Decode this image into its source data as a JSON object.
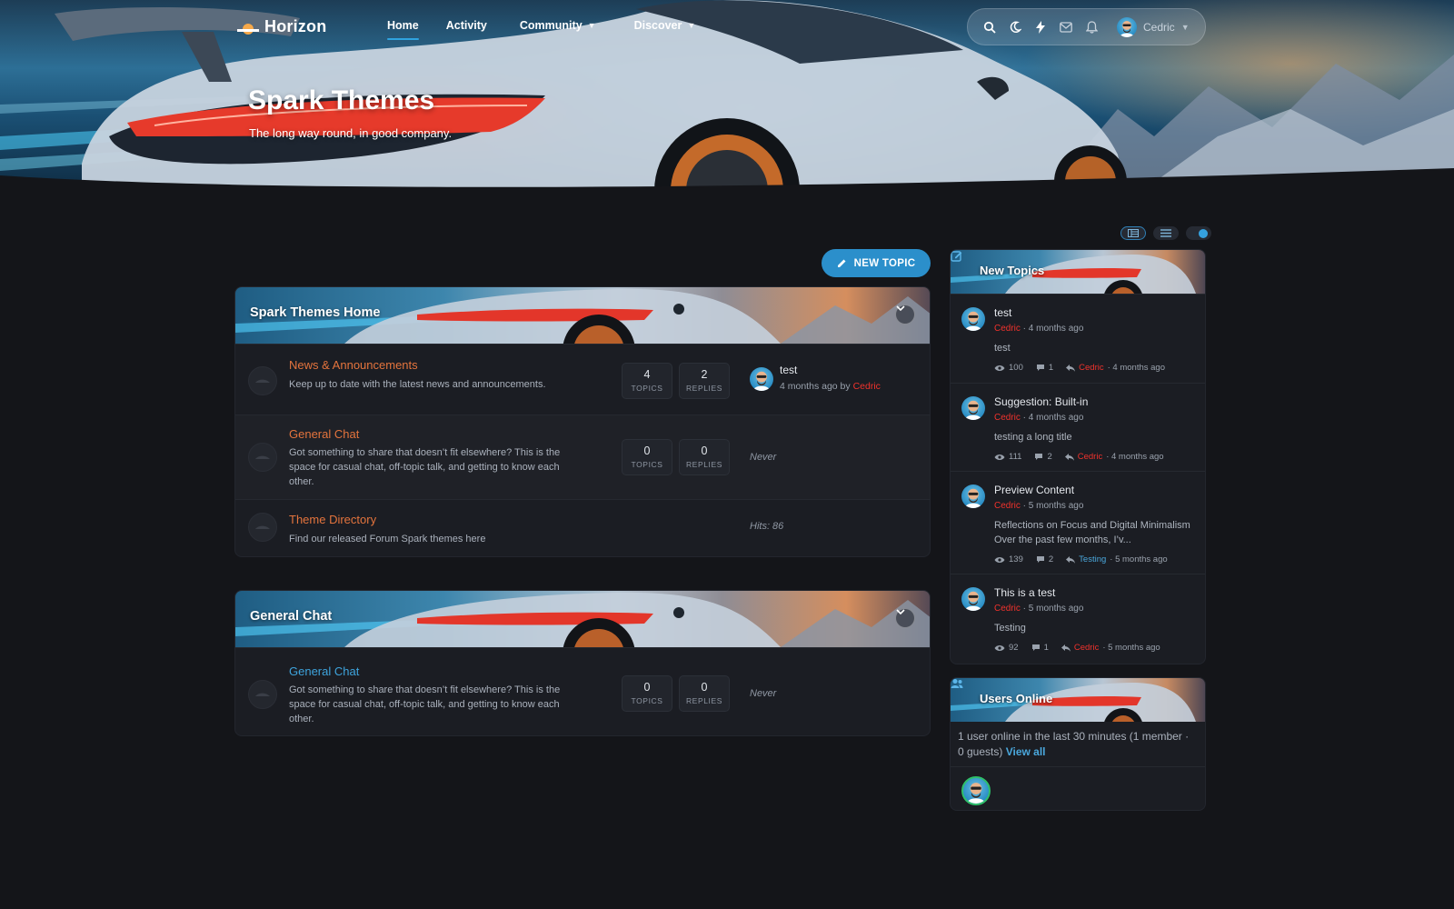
{
  "app": {
    "brand": "Horizon"
  },
  "nav": {
    "items": [
      {
        "label": "Home",
        "active": true,
        "dropdown": false
      },
      {
        "label": "Activity",
        "active": false,
        "dropdown": false
      },
      {
        "label": "Community",
        "active": false,
        "dropdown": true
      },
      {
        "label": "Discover",
        "active": false,
        "dropdown": true
      }
    ]
  },
  "toolbar": {
    "icons": [
      "search-icon",
      "moon-icon",
      "lightning-icon",
      "mail-icon",
      "bell-icon"
    ],
    "user_name": "Cedric"
  },
  "hero": {
    "title": "Spark Themes",
    "subtitle": "The long way round, in good company."
  },
  "actions": {
    "new_topic": "NEW TOPIC"
  },
  "categories": [
    {
      "title": "Spark Themes Home",
      "forums": [
        {
          "title": "News & Announcements",
          "description": "Keep up to date with the latest news and announcements.",
          "topics": "4",
          "replies": "2",
          "last_post": {
            "title": "test",
            "meta_prefix": "4 months ago by ",
            "author": "Cedric"
          }
        },
        {
          "title": "General Chat",
          "description": "Got something to share that doesn’t fit elsewhere? This is the space for casual chat, off-topic talk, and getting to know each other.",
          "topics": "0",
          "replies": "0",
          "last_post_text": "Never"
        },
        {
          "title": "Theme Directory",
          "description": "Find our released Forum Spark themes here",
          "hits": "Hits: 86"
        }
      ]
    },
    {
      "title": "General Chat",
      "forums": [
        {
          "title": "General Chat",
          "description": "Got something to share that doesn’t fit elsewhere? This is the space for casual chat, off-topic talk, and getting to know each other.",
          "topics": "0",
          "replies": "0",
          "last_post_text": "Never"
        }
      ]
    }
  ],
  "stat_labels": {
    "topics": "TOPICS",
    "replies": "REPLIES"
  },
  "sidebar": {
    "new_topics": {
      "title": "New Topics",
      "items": [
        {
          "title": "test",
          "author": "Cedric",
          "time": " · 4 months ago",
          "excerpt": "test",
          "views": "100",
          "replies": "1",
          "last_by": "Cedric",
          "last_time": " · 4 months ago"
        },
        {
          "title": "Suggestion: Built-in",
          "author": "Cedric",
          "time": " · 4 months ago",
          "excerpt": "testing a long title",
          "views": "111",
          "replies": "2",
          "last_by": "Cedric",
          "last_time": " · 4 months ago"
        },
        {
          "title": "Preview Content",
          "author": "Cedric",
          "time": " · 5 months ago",
          "excerpt": "Reflections on Focus and Digital Minimalism Over the past few months, I’v...",
          "views": "139",
          "replies": "2",
          "last_by": "Testing",
          "last_time": " · 5 months ago"
        },
        {
          "title": "This is a test",
          "author": "Cedric",
          "time": " · 5 months ago",
          "excerpt": "Testing",
          "views": "92",
          "replies": "1",
          "last_by": "Cedric",
          "last_time": " · 5 months ago"
        }
      ]
    },
    "users_online": {
      "title": "Users Online",
      "text": "1 user online in the last 30 minutes (1 member · 0 guests)",
      "link": "View all"
    }
  },
  "colors": {
    "accent": "#2b8fcb",
    "forum_title": "#e4743d",
    "author_red": "#f0322c",
    "background": "#141519",
    "card": "#1b1d23"
  }
}
